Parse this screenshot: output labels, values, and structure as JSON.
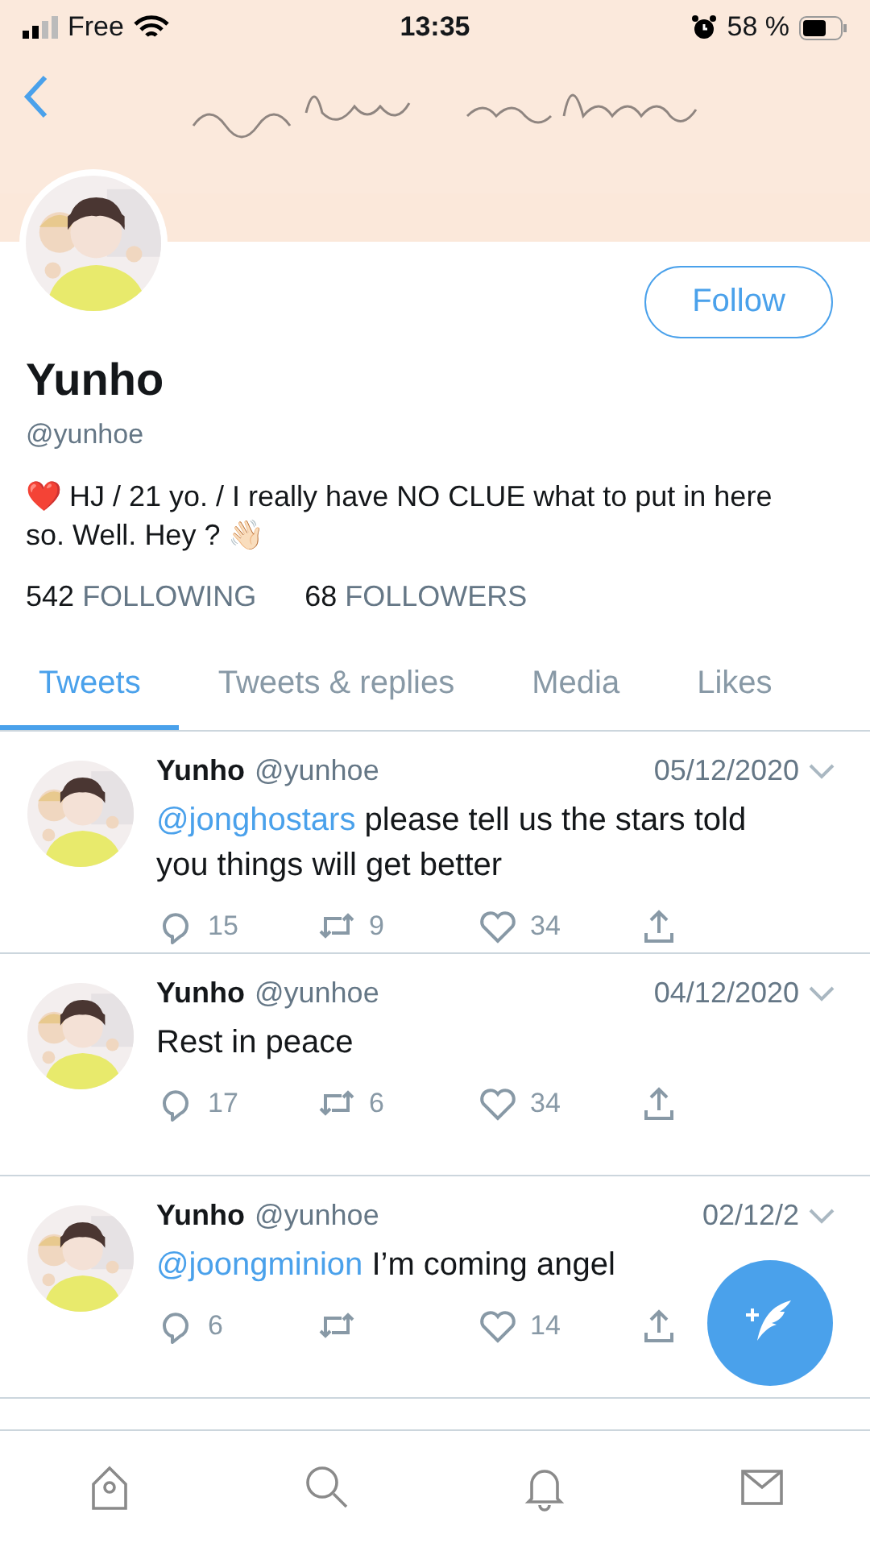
{
  "status_bar": {
    "carrier": "Free",
    "time": "13:35",
    "battery": "58 %"
  },
  "profile": {
    "name": "Yunho",
    "handle": "@yunhoe",
    "bio": "❤️ HJ / 21 yo. / I really have NO CLUE what to put in here so. Well. Hey ? 👋🏻",
    "following_count": "542",
    "following_label": "FOLLOWING",
    "followers_count": "68",
    "followers_label": "FOLLOWERS",
    "follow_button": "Follow"
  },
  "tabs": [
    {
      "label": "Tweets",
      "selected": true
    },
    {
      "label": "Tweets & replies",
      "selected": false
    },
    {
      "label": "Media",
      "selected": false
    },
    {
      "label": "Likes",
      "selected": false
    }
  ],
  "tweets": [
    {
      "name": "Yunho",
      "handle": "@yunhoe",
      "date": "05/12/2020",
      "mention": "@jonghostars",
      "text": "please tell us the stars told you things will get better",
      "replies": "15",
      "retweets": "9",
      "likes": "34"
    },
    {
      "name": "Yunho",
      "handle": "@yunhoe",
      "date": "04/12/2020",
      "text": "Rest in peace",
      "replies": "17",
      "retweets": "6",
      "likes": "34"
    },
    {
      "name": "Yunho",
      "handle": "@yunhoe",
      "date": "02/12/2",
      "mention": "@joongminion",
      "text": "I’m coming angel",
      "replies": "6",
      "likes": "14"
    }
  ]
}
